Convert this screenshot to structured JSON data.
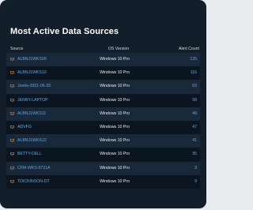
{
  "panel": {
    "title": "Most Active Data Sources",
    "columns": {
      "source": "Source",
      "os": "OS Version",
      "count": "Alert Count"
    },
    "rows": [
      {
        "source": "ALBNJ1WKS09",
        "os": "Windows 10 Pro",
        "count": "135"
      },
      {
        "source": "ALBNJ1WKS10",
        "os": "Windows 10 Pro",
        "count": "116"
      },
      {
        "source": "Jsetto-2021-06-20",
        "os": "Windows 10 Pro",
        "count": "63"
      },
      {
        "source": "JENNY-LAPTOP",
        "os": "Windows 10 Pro",
        "count": "58"
      },
      {
        "source": "ALBNJ1WKS11",
        "os": "Windows 10 Pro",
        "count": "48"
      },
      {
        "source": "ADVFG",
        "os": "Windows 10 Pro",
        "count": "47"
      },
      {
        "source": "ALBNJ1WKS12",
        "os": "Windows 10 Pro",
        "count": "41"
      },
      {
        "source": "BETTY-DELL",
        "os": "Windows 10 Pro",
        "count": "35"
      },
      {
        "source": "CFM-WKS-0721A",
        "os": "Windows 10 Pro",
        "count": "9"
      },
      {
        "source": "TDICKINSON-DT",
        "os": "Windows 10 Pro",
        "count": "9"
      }
    ],
    "row_icon": "monitor-icon",
    "colors": {
      "background": "#121e2a",
      "link": "#62a8e0",
      "icon": "#e0782e"
    }
  }
}
